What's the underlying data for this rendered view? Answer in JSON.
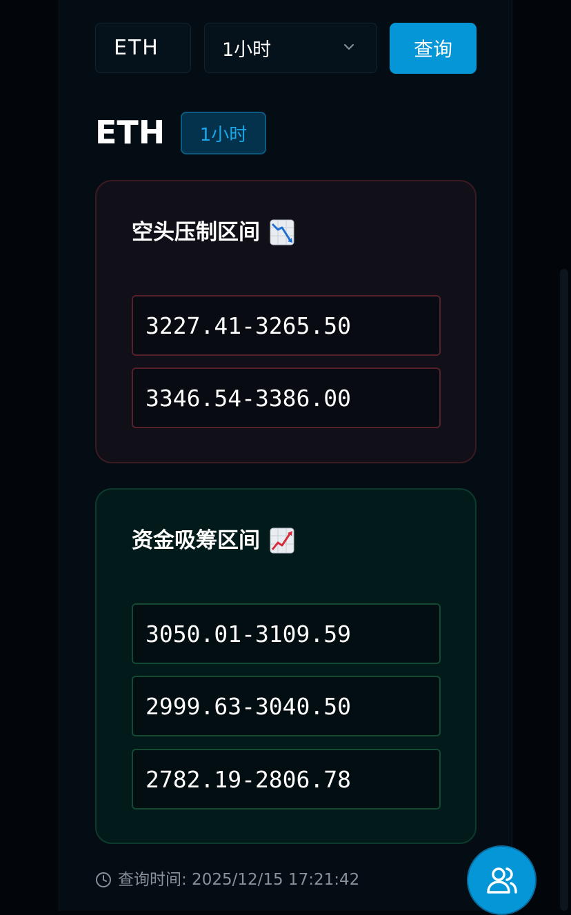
{
  "query_form": {
    "symbol_value": "ETH",
    "interval_selected": "1小时",
    "submit_label": "查询"
  },
  "result": {
    "symbol": "ETH",
    "interval_badge": "1小时"
  },
  "resistance_card": {
    "title": "空头压制区间",
    "icon": "chart-decreasing-icon",
    "accent_color": "#56212a",
    "ranges": [
      "3227.41-3265.50",
      "3346.54-3386.00"
    ]
  },
  "support_card": {
    "title": "资金吸筹区间",
    "icon": "chart-increasing-icon",
    "accent_color": "#144a33",
    "ranges": [
      "3050.01-3109.59",
      "2999.63-3040.50",
      "2782.19-2806.78"
    ]
  },
  "footer": {
    "query_time": "查询时间: 2025/12/15 17:21:42"
  },
  "floating": {
    "icon": "users-icon"
  },
  "colors": {
    "accent": "#0596d8",
    "background": "#050d14"
  }
}
